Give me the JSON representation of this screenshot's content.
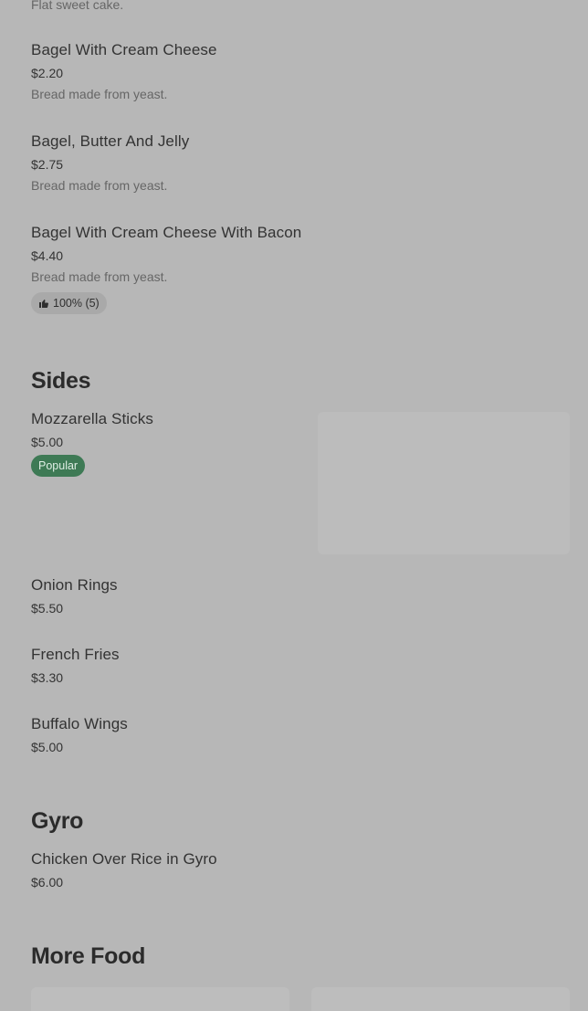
{
  "items_top": [
    {
      "desc": "Flat sweet cake."
    },
    {
      "name": "Bagel With Cream Cheese",
      "price": "$2.20",
      "desc": "Bread made from yeast."
    },
    {
      "name": "Bagel, Butter And Jelly",
      "price": "$2.75",
      "desc": "Bread made from yeast."
    },
    {
      "name": "Bagel With Cream Cheese With Bacon",
      "price": "$4.40",
      "desc": "Bread made from yeast.",
      "rating": "100% (5)"
    }
  ],
  "sides": {
    "title": "Sides",
    "items": [
      {
        "name": "Mozzarella Sticks",
        "price": "$5.00",
        "badge": "Popular"
      },
      {
        "name": "Onion Rings",
        "price": "$5.50"
      },
      {
        "name": "French Fries",
        "price": "$3.30"
      },
      {
        "name": "Buffalo Wings",
        "price": "$5.00"
      }
    ]
  },
  "gyro": {
    "title": "Gyro",
    "items": [
      {
        "name": "Chicken Over Rice in Gyro",
        "price": "$6.00"
      }
    ]
  },
  "more_food": {
    "title": "More Food"
  },
  "colors": {
    "background": "#b7b7b7",
    "popular_badge": "#3e7a55",
    "rating_pill": "#a9a9a9"
  },
  "icons": {
    "rating": "thumbs-up-icon"
  }
}
